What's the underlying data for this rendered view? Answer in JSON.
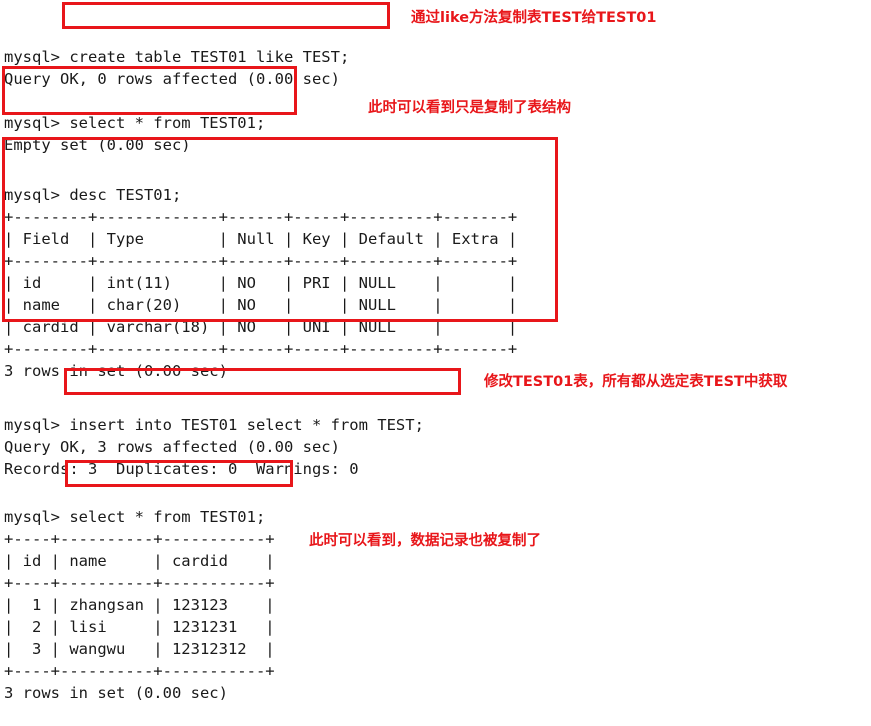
{
  "terminal": {
    "prompt": "mysql>",
    "blocks": {
      "b1": "mysql> create table TEST01 like TEST;\nQuery OK, 0 rows affected (0.00 sec)",
      "b2": "mysql> select * from TEST01;\nEmpty set (0.00 sec)",
      "b3": "mysql> desc TEST01;\n+--------+-------------+------+-----+---------+-------+\n| Field  | Type        | Null | Key | Default | Extra |\n+--------+-------------+------+-----+---------+-------+\n| id     | int(11)     | NO   | PRI | NULL    |       |\n| name   | char(20)    | NO   |     | NULL    |       |\n| cardid | varchar(18) | NO   | UNI | NULL    |       |\n+--------+-------------+------+-----+---------+-------+\n3 rows in set (0.00 sec)",
      "b4": "mysql> insert into TEST01 select * from TEST;\nQuery OK, 3 rows affected (0.00 sec)\nRecords: 3  Duplicates: 0  Warnings: 0",
      "b5": "mysql> select * from TEST01;\n+----+----------+-----------+\n| id | name     | cardid    |\n+----+----------+-----------+\n|  1 | zhangsan | 123123    |\n|  2 | lisi     | 1231231   |\n|  3 | wangwu   | 12312312  |\n+----+----------+-----------+\n3 rows in set (0.00 sec)"
    },
    "commands": {
      "create_table": "create table TEST01 like TEST;",
      "select_empty": "select * from TEST01;",
      "desc_table": "desc TEST01;",
      "insert_select": "insert into TEST01 select * from TEST;",
      "select_rows": "select * from TEST01;"
    },
    "results": {
      "create_ok": "Query OK, 0 rows affected (0.00 sec)",
      "empty_set": "Empty set (0.00 sec)",
      "desc_rows": "3 rows in set (0.00 sec)",
      "insert_ok": "Query OK, 3 rows affected (0.00 sec)",
      "insert_records": "Records: 3  Duplicates: 0  Warnings: 0",
      "select_rows_count": "3 rows in set (0.00 sec)"
    }
  },
  "desc_table": {
    "headers": [
      "Field",
      "Type",
      "Null",
      "Key",
      "Default",
      "Extra"
    ],
    "rows": [
      [
        "id",
        "int(11)",
        "NO",
        "PRI",
        "NULL",
        ""
      ],
      [
        "name",
        "char(20)",
        "NO",
        "",
        "NULL",
        ""
      ],
      [
        "cardid",
        "varchar(18)",
        "NO",
        "UNI",
        "NULL",
        ""
      ]
    ]
  },
  "data_table": {
    "headers": [
      "id",
      "name",
      "cardid"
    ],
    "rows": [
      [
        "1",
        "zhangsan",
        "123123"
      ],
      [
        "2",
        "lisi",
        "1231231"
      ],
      [
        "3",
        "wangwu",
        "12312312"
      ]
    ]
  },
  "annotations": {
    "a1": "通过like方法复制表TEST给TEST01",
    "a2": "此时可以看到只是复制了表结构",
    "a3": "修改TEST01表，所有都从选定表TEST中获取",
    "a4": "此时可以看到，数据记录也被复制了"
  },
  "colors": {
    "highlight": "#e8161a",
    "annotation": "#e8161a",
    "text": "#1a1a1a",
    "background": "#ffffff"
  }
}
